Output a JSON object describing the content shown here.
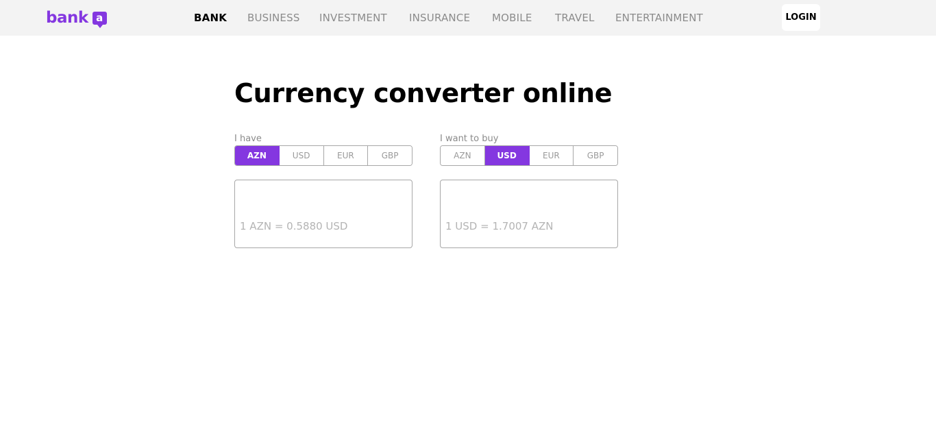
{
  "brand": {
    "name": "bank",
    "mark": "a",
    "color": "#8437e0"
  },
  "nav": {
    "items": [
      {
        "label": "BANK",
        "active": true
      },
      {
        "label": "BUSINESS"
      },
      {
        "label": "INVESTMENT"
      },
      {
        "label": "INSURANCE"
      },
      {
        "label": "MOBILE"
      },
      {
        "label": "TRAVEL"
      },
      {
        "label": "ENTERTAINMENT"
      }
    ],
    "login_label": "LOGIN"
  },
  "page": {
    "title": "Currency converter online"
  },
  "converter": {
    "have": {
      "label": "I have",
      "currencies": [
        "AZN",
        "USD",
        "EUR",
        "GBP"
      ],
      "selected": "AZN",
      "amount": "",
      "rate_text": "1 AZN = 0.5880 USD"
    },
    "buy": {
      "label": "I want to buy",
      "currencies": [
        "AZN",
        "USD",
        "EUR",
        "GBP"
      ],
      "selected": "USD",
      "amount": "",
      "rate_text": "1 USD = 1.7007 AZN"
    }
  }
}
